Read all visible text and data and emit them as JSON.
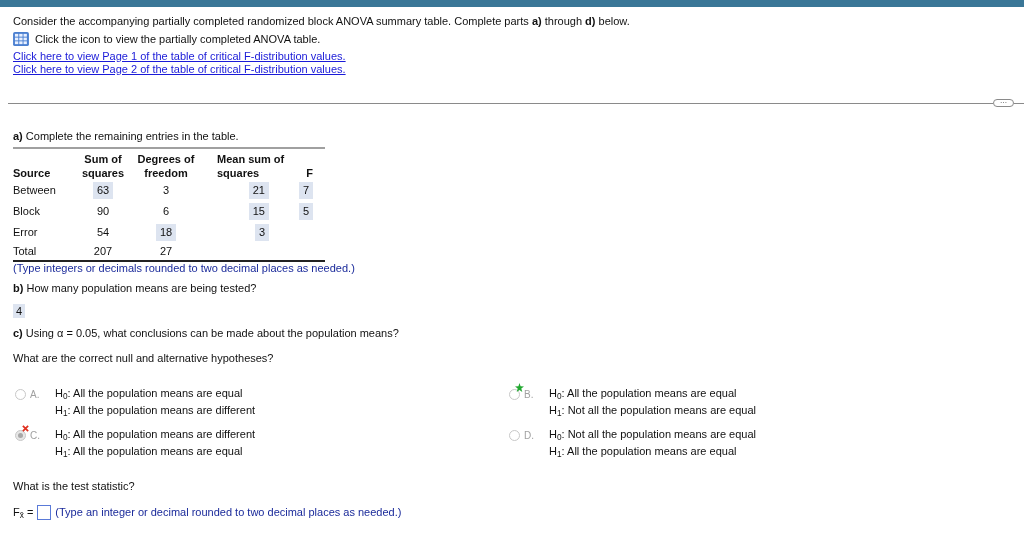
{
  "intro": "Consider the accompanying partially completed randomized block ANOVA summary table. Complete parts **a)** through **d)** below.",
  "icon_note": "Click the icon to view the partially completed ANOVA table.",
  "links": [
    "Click here to view Page 1 of the table of critical F-distribution values.",
    "Click here to view Page 2 of the table of critical F-distribution values."
  ],
  "expand_button": "···",
  "part_a": {
    "prompt": "**a)** Complete the remaining entries in the table.",
    "columns": [
      "Source",
      "Sum of squares",
      "Degrees of freedom",
      "Mean sum of squares",
      "F"
    ],
    "rows": [
      {
        "cells": [
          {
            "text": "Between",
            "answered": false
          },
          {
            "text": "63",
            "answered": true
          },
          {
            "text": "3",
            "answered": false
          },
          {
            "text": "21",
            "answered": true
          },
          {
            "text": "7",
            "answered": true
          }
        ]
      },
      {
        "cells": [
          {
            "text": "Block",
            "answered": false
          },
          {
            "text": "90",
            "answered": false
          },
          {
            "text": "6",
            "answered": false
          },
          {
            "text": "15",
            "answered": true
          },
          {
            "text": "5",
            "answered": true
          }
        ]
      },
      {
        "cells": [
          {
            "text": "Error",
            "answered": false
          },
          {
            "text": "54",
            "answered": false
          },
          {
            "text": "18",
            "answered": true
          },
          {
            "text": "3",
            "answered": true
          }
        ]
      },
      {
        "cells": [
          {
            "text": "Total",
            "answered": false
          },
          {
            "text": "207",
            "answered": false
          },
          {
            "text": "27",
            "answered": false
          }
        ]
      }
    ],
    "note": "(Type integers or decimals rounded to two decimal places as needed.)"
  },
  "part_b": {
    "prompt": "**b)** How many population means are being tested?",
    "answer": "4"
  },
  "part_c": {
    "prompt": "**c)** Using α = 0.05, what conclusions can be made about the population means?",
    "question": "What are the correct null and alternative hypotheses?",
    "options": [
      {
        "letter": "A.",
        "h0": "H$_{0}$: All the population means are equal",
        "h1": "H$_{1}$: All the population means are different",
        "selected": false,
        "starred": false,
        "crossed": false
      },
      {
        "letter": "B.",
        "h0": "H$_{0}$: All the population means are equal",
        "h1": "H$_{1}$: Not all the population means are equal",
        "selected": false,
        "starred": true,
        "crossed": false
      },
      {
        "letter": "C.",
        "h0": "H$_{0}$: All the population means are different",
        "h1": "H$_{1}$: All the population means are equal",
        "selected": true,
        "starred": false,
        "crossed": true
      },
      {
        "letter": "D.",
        "h0": "H$_{0}$: Not all the population means are equal",
        "h1": "H$_{1}$: All the population means are equal",
        "selected": false,
        "starred": false,
        "crossed": false
      }
    ],
    "test_question": "What is the test statistic?",
    "stat_label": "F$_{x̄}$ =",
    "stat_note": "(Type an integer or decimal rounded to two decimal places as needed.)"
  }
}
